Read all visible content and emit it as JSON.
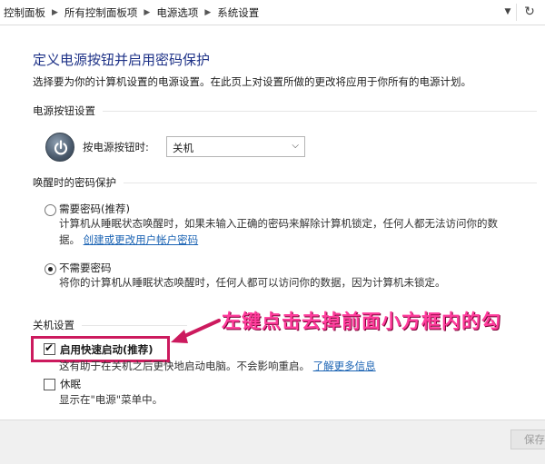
{
  "breadcrumb": {
    "items": [
      "控制面板",
      "所有控制面板项",
      "电源选项",
      "系统设置"
    ]
  },
  "page": {
    "title": "定义电源按钮并启用密码保护",
    "subtitle": "选择要为你的计算机设置的电源设置。在此页上对设置所做的更改将应用于你所有的电源计划。"
  },
  "power_button_section": {
    "heading": "电源按钮设置",
    "when_label": "按电源按钮时:",
    "selected_action": "关机"
  },
  "wake_password_section": {
    "heading": "唤醒时的密码保护",
    "option_require": {
      "label": "需要密码(推荐)",
      "desc_line1": "计算机从睡眠状态唤醒时，如果未输入正确的密码来解除计算机锁定，任何人都无法访问你的数",
      "desc_line2_prefix": "据。",
      "link": "创建或更改用户帐户密码",
      "selected": false
    },
    "option_no_require": {
      "label": "不需要密码",
      "desc": "将你的计算机从睡眠状态唤醒时，任何人都可以访问你的数据，因为计算机未锁定。",
      "selected": true
    }
  },
  "shutdown_section": {
    "heading": "关机设置",
    "fast_startup": {
      "label": "启用快速启动(推荐)",
      "checked": true,
      "desc": "这有助于在关机之后更快地启动电脑。不会影响重启。",
      "link": "了解更多信息"
    },
    "hibernate": {
      "label": "休眠",
      "checked": false,
      "desc": "显示在\"电源\"菜单中。"
    }
  },
  "annotation": {
    "text": "左键点击去掉前面小方框内的勾",
    "color": "#ff3c9c"
  },
  "footer": {
    "save_label": "保存"
  }
}
